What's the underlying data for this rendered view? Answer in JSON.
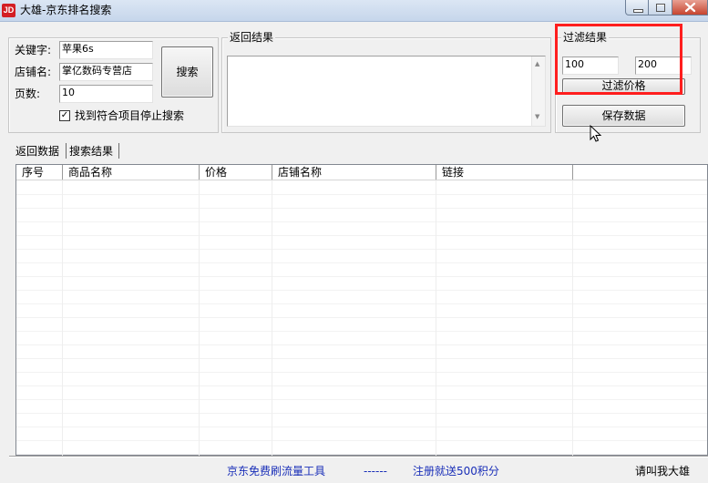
{
  "window": {
    "title": "大雄-京东排名搜索",
    "icon_text": "JD",
    "icons": {
      "minimize": "minimize-icon",
      "maximize": "maximize-icon",
      "close": "close-icon"
    }
  },
  "search_form": {
    "keyword_label": "关键字:",
    "keyword_value": "苹果6s",
    "shop_label": "店铺名:",
    "shop_value": "掌亿数码专营店",
    "pages_label": "页数:",
    "pages_value": "10",
    "stop_checkbox_label": "找到符合项目停止搜索",
    "stop_checked": true,
    "search_button": "搜索"
  },
  "result_box": {
    "title": "返回结果",
    "content": ""
  },
  "filter": {
    "title": "过滤结果",
    "min_price": "100",
    "max_price": "200",
    "filter_button": "过滤价格",
    "save_button": "保存数据"
  },
  "tabs": [
    {
      "label": "返回数据",
      "active": true
    },
    {
      "label": "搜索结果",
      "active": false
    }
  ],
  "table": {
    "columns": [
      "序号",
      "商品名称",
      "价格",
      "店铺名称",
      "链接"
    ],
    "rows": []
  },
  "status_bar": {
    "promo": "京东免费刷流量工具",
    "separator": "------",
    "register": "注册就送500积分",
    "author": "请叫我大雄"
  },
  "colors": {
    "highlight": "#ff1e1e",
    "status_link": "#1a2fb8",
    "title_bar": "#c6d6eb"
  }
}
